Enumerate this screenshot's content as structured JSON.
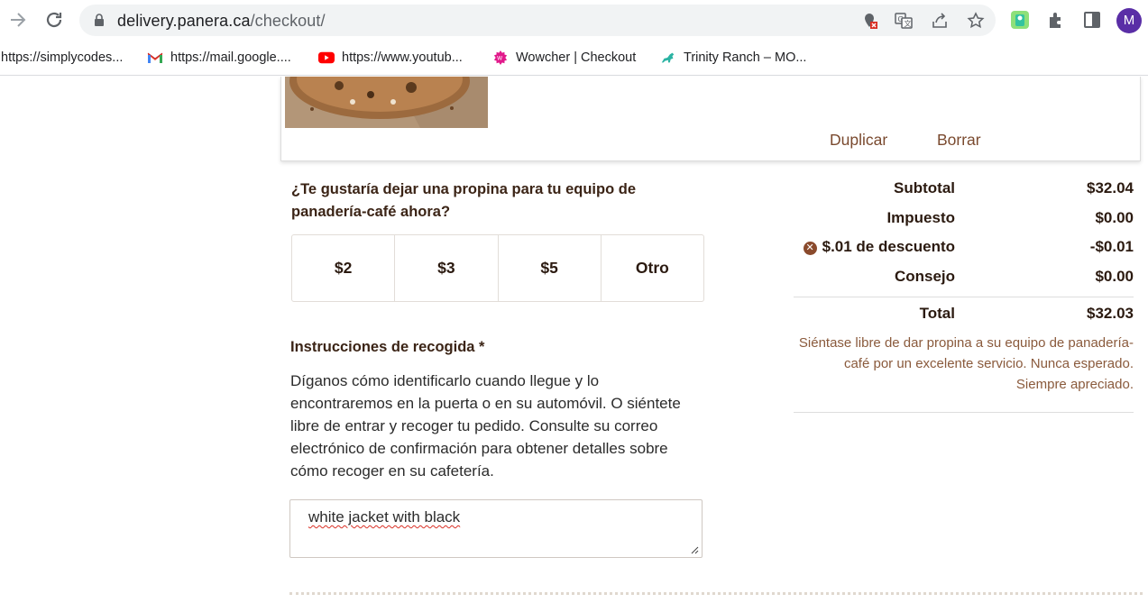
{
  "browser": {
    "url_host": "delivery.panera.ca",
    "url_path": "/checkout/",
    "avatar_letter": "M",
    "bookmarks": [
      {
        "label": "https://simplycodes...",
        "icon": "none"
      },
      {
        "label": "https://mail.google....",
        "icon": "gmail-icon"
      },
      {
        "label": "https://www.youtub...",
        "icon": "youtube-icon"
      },
      {
        "label": "Wowcher | Checkout",
        "icon": "wowcher-icon"
      },
      {
        "label": "Trinity Ranch – MO...",
        "icon": "horse-icon"
      }
    ]
  },
  "item_card": {
    "duplicate_label": "Duplicar",
    "delete_label": "Borrar"
  },
  "tip": {
    "question": "¿Te gustaría dejar una propina para tu equipo de panadería-café ahora?",
    "options": [
      "$2",
      "$3",
      "$5",
      "Otro"
    ]
  },
  "pickup": {
    "title": "Instrucciones de recogida *",
    "description": "Díganos cómo identificarlo cuando llegue y lo encontraremos en la puerta o en su automóvil. O siéntete libre de entrar y recoger tu pedido. Consulte su correo electrónico de confirmación para obtener detalles sobre cómo recoger en su cafetería.",
    "input_value": "white jacket with black"
  },
  "summary": {
    "subtotal_label": "Subtotal",
    "subtotal_value": "$32.04",
    "tax_label": "Impuesto",
    "tax_value": "$0.00",
    "discount_label": "$.01 de descuento",
    "discount_value": "-$0.01",
    "tip_label": "Consejo",
    "tip_value": "$0.00",
    "total_label": "Total",
    "total_value": "$32.03",
    "note": "Siéntase libre de dar propina a su equipo de panadería-café por un excelente servicio. Nunca esperado. Siempre apreciado."
  },
  "colors": {
    "brand_brown": "#7a4a2f",
    "text_dark": "#2b1a10",
    "avatar_bg": "#5a2ea6"
  }
}
